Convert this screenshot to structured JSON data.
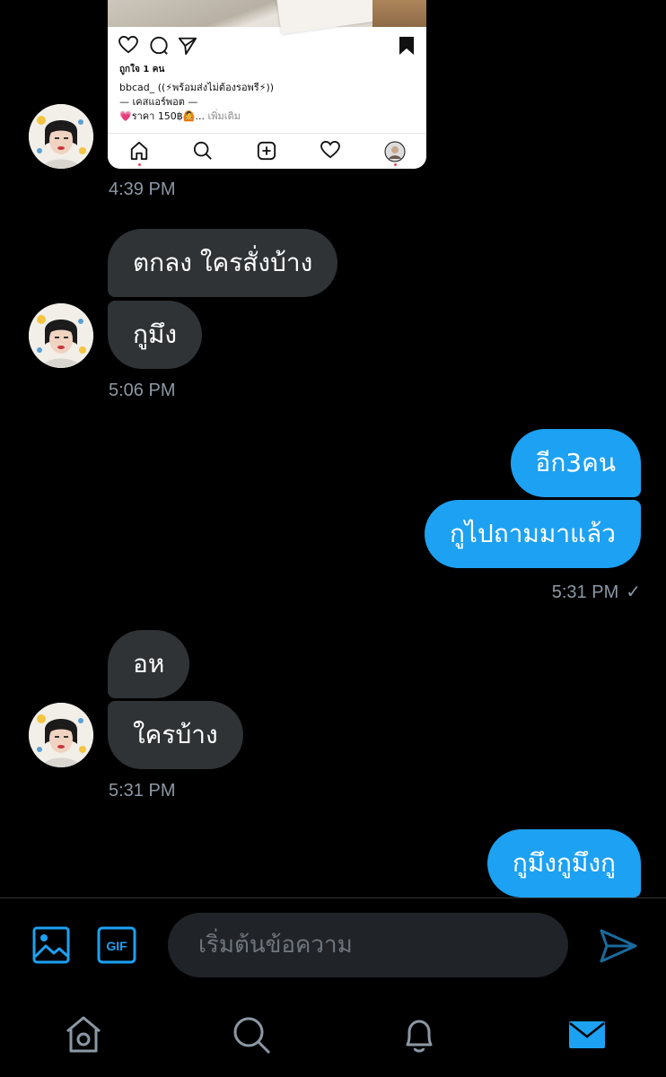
{
  "shared_post": {
    "likes": "ถูกใจ 1 คน",
    "caption_line1": "bbcad_ ((⚡พร้อมส่งไม่ต้องรอพรี⚡))",
    "caption_line2": "— เคสแอร์พอต —",
    "caption_line3": "💗ราคา 150฿🙆...",
    "more": "เพิ่มเติม"
  },
  "messages": {
    "ts1": "4:39 PM",
    "m1": "ตกลง ใครสั่งบ้าง",
    "m2": "กูมึง",
    "ts2": "5:06 PM",
    "m3": "อีก3คน",
    "m4": "กูไปถามมาแล้ว",
    "ts3": "5:31 PM",
    "ts3_check": "✓",
    "m5": "อห",
    "m6": "ใครบ้าง",
    "ts4": "5:31 PM",
    "m7": "กูมึงกูมึงกู"
  },
  "composer": {
    "placeholder": "เริ่มต้นข้อความ",
    "gif_label": "GIF"
  },
  "colors": {
    "accent": "#1da1f2",
    "incoming_bubble": "#2f3336",
    "timestamp": "#8b98a5"
  },
  "icons": [
    "heart-icon",
    "comment-icon",
    "send-icon",
    "bookmark-icon",
    "home-icon",
    "search-icon",
    "add-post-icon",
    "activity-icon",
    "profile-icon",
    "image-icon",
    "gif-icon",
    "send-message-icon",
    "notifications-icon",
    "messages-icon"
  ]
}
